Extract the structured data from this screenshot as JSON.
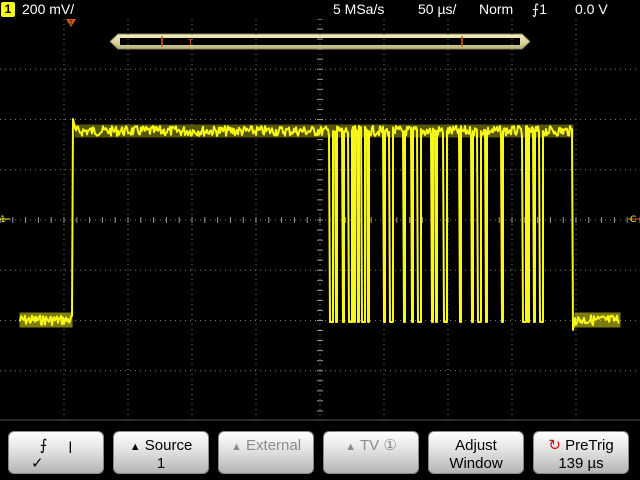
{
  "status": {
    "channel_number": "1",
    "channel_scale": "200 mV/",
    "sample_rate": "5 MSa/s",
    "time_scale": "50 µs/",
    "trigger_mode": "Norm",
    "trigger_source": "1",
    "trigger_level": "0.0 V"
  },
  "markers": {
    "trigger_label": "T",
    "ch1_ground": "1",
    "trig_level_label": "C"
  },
  "softkeys": {
    "slope_mark": "✓",
    "source_label": "Source",
    "source_value": "1",
    "external_label": "External",
    "tv_label": "TV",
    "tv_badge": "①",
    "adjust_line1": "Adjust",
    "adjust_line2": "Window",
    "pretrig_label": "PreTrig",
    "pretrig_value": "139 µs"
  },
  "colors": {
    "trace": "#f7f71a",
    "marker": "#e05a1a",
    "grid": "#7a7a7a"
  }
}
